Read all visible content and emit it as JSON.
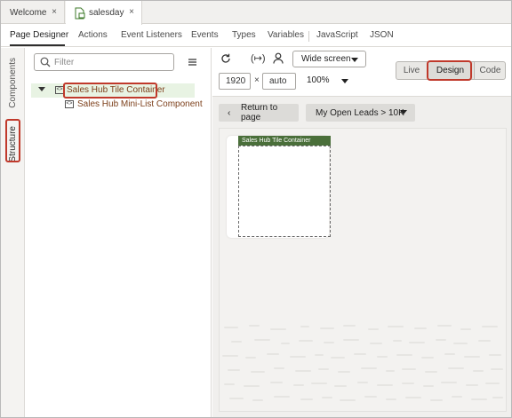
{
  "file_tabs": [
    {
      "label": "Welcome",
      "close": "×"
    },
    {
      "label": "salesday",
      "close": "×"
    }
  ],
  "designer_tabs": [
    "Page Designer",
    "Actions",
    "Event Listeners",
    "Events",
    "Types",
    "Variables",
    "JavaScript",
    "JSON"
  ],
  "side_tabs": {
    "components": "Components",
    "structure": "Structure"
  },
  "structure": {
    "filter_placeholder": "Filter",
    "items": [
      {
        "label": "Sales Hub Tile Container",
        "expanded": true,
        "selected": true
      },
      {
        "label": "Sales Hub Mini-List Component"
      }
    ]
  },
  "toolbar": {
    "screen_size": "Wide screen",
    "width": "1920",
    "times": "×",
    "height": "auto",
    "zoom": "100%",
    "modes": [
      "Live",
      "Design",
      "Code"
    ],
    "active_mode": "Design"
  },
  "page": {
    "return_label": "Return to page",
    "leads_label": "My Open Leads > 10K",
    "tile_label": "Sales Hub Tile Container"
  },
  "colors": {
    "accent_red": "#c0392b",
    "selected_bg": "#e8f3e3",
    "tile_label_bg": "#4a6f3a",
    "tree_text": "#7c3f1a"
  }
}
